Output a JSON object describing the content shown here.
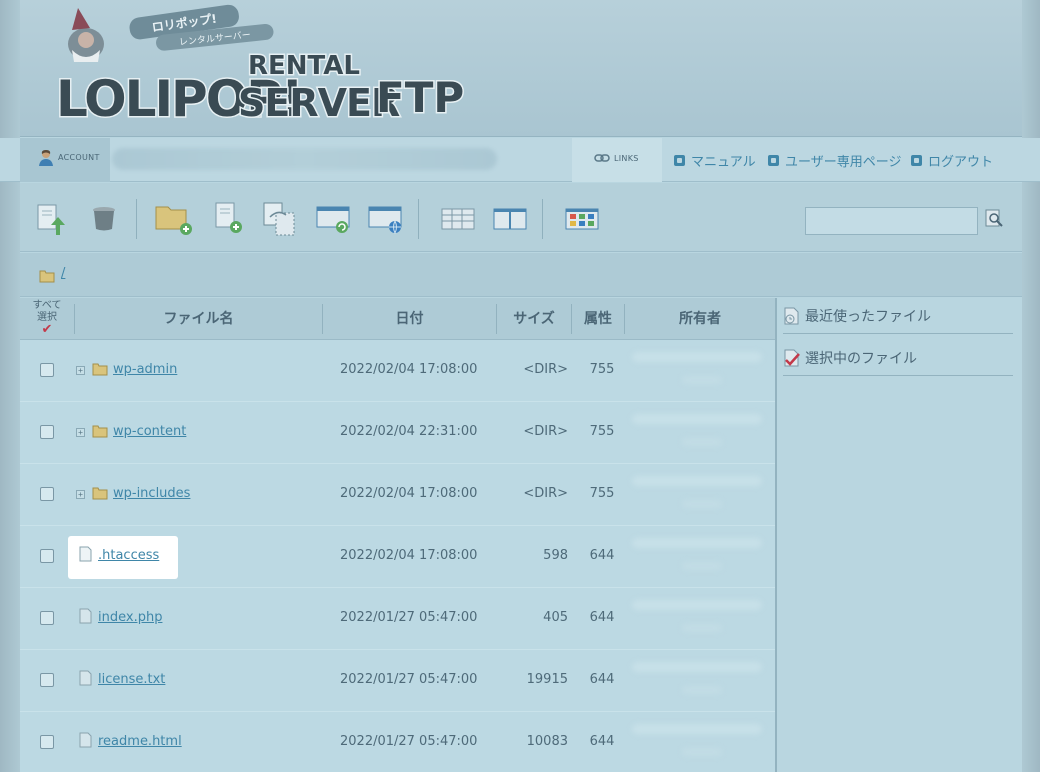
{
  "header": {
    "logo_text": "LOLIPOP! RENTAL SERVER FTP",
    "logo_sub": "ロリポップ! レンタルサーバー"
  },
  "account_bar": {
    "account_label": "ACCOUNT",
    "links_label": "LINKS",
    "links": [
      {
        "label": "マニュアル"
      },
      {
        "label": "ユーザー専用ページ"
      },
      {
        "label": "ログアウト"
      }
    ]
  },
  "toolbar": {
    "buttons": [
      "upload-icon",
      "trash-icon",
      "new-folder-icon",
      "new-file-icon",
      "copy-icon",
      "move-icon",
      "web-open-icon",
      "list-view-icon",
      "split-view-icon",
      "grid-view-icon"
    ],
    "search_value": ""
  },
  "breadcrumb": {
    "path": "/"
  },
  "table": {
    "select_all_label": "すべて\n選択",
    "headers": {
      "name": "ファイル名",
      "date": "日付",
      "size": "サイズ",
      "attr": "属性",
      "owner": "所有者"
    },
    "rows": [
      {
        "name": "wp-admin",
        "date": "2022/02/04 17:08:00",
        "size": "<DIR>",
        "attr": "755",
        "type": "folder"
      },
      {
        "name": "wp-content",
        "date": "2022/02/04 22:31:00",
        "size": "<DIR>",
        "attr": "755",
        "type": "folder"
      },
      {
        "name": "wp-includes",
        "date": "2022/02/04 17:08:00",
        "size": "<DIR>",
        "attr": "755",
        "type": "folder"
      },
      {
        "name": ".htaccess",
        "date": "2022/02/04 17:08:00",
        "size": "598",
        "attr": "644",
        "type": "file"
      },
      {
        "name": "index.php",
        "date": "2022/01/27 05:47:00",
        "size": "405",
        "attr": "644",
        "type": "file"
      },
      {
        "name": "license.txt",
        "date": "2022/01/27 05:47:00",
        "size": "19915",
        "attr": "644",
        "type": "file"
      },
      {
        "name": "readme.html",
        "date": "2022/01/27 05:47:00",
        "size": "10083",
        "attr": "644",
        "type": "file"
      }
    ]
  },
  "side_panel": {
    "recent_label": "最近使ったファイル",
    "selected_label": "選択中のファイル"
  },
  "colors": {
    "link": "#3f86a8",
    "background": "#b9d6e0",
    "checkmark": "#c3394a"
  }
}
